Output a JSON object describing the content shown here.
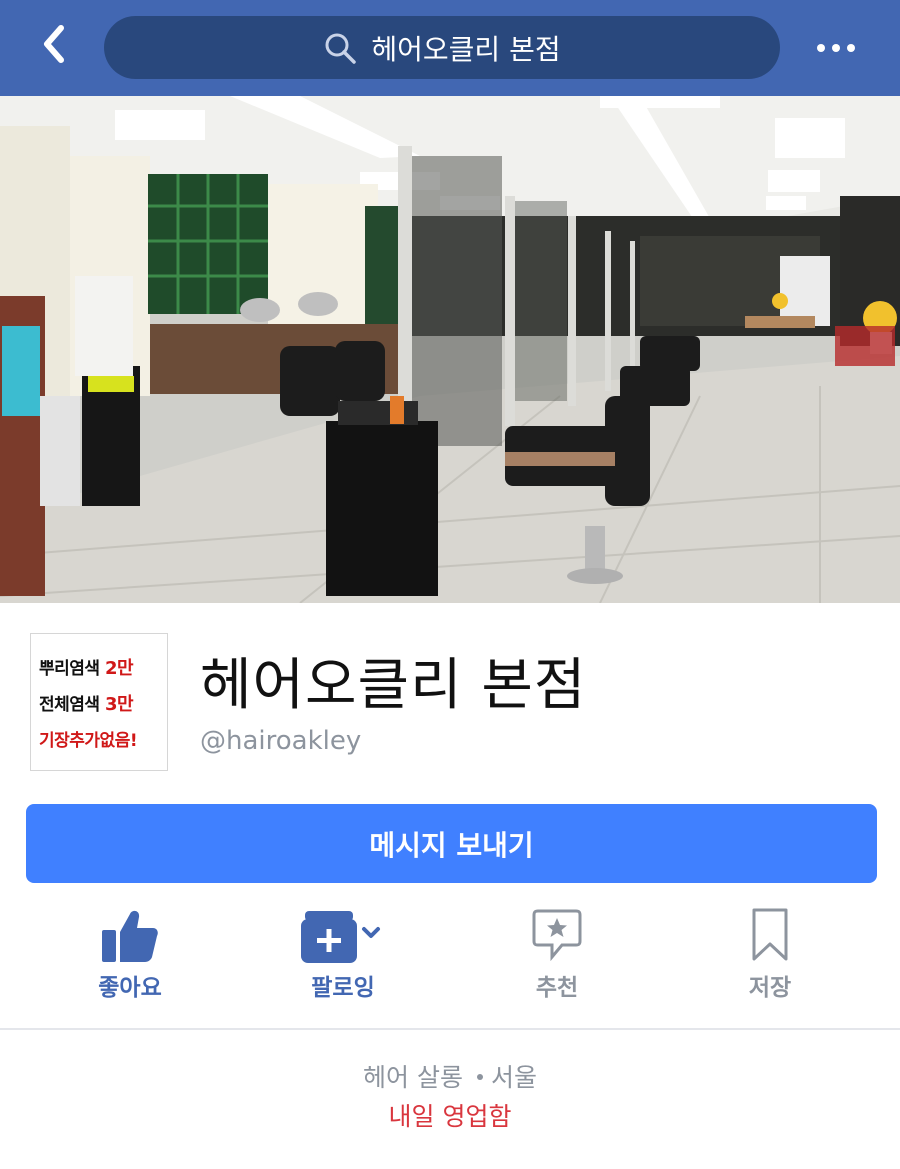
{
  "header": {
    "search_text": "헤어오클리 본점",
    "back_icon": "back-chevron-icon",
    "more_icon": "more-dots-icon",
    "bar_color": "#4267b2"
  },
  "cover": {
    "icon": "salon-interior-photo"
  },
  "profile": {
    "avatar_lines": [
      {
        "text": "뿌리염색",
        "num": "2만"
      },
      {
        "text": "전체염색",
        "num": "3만"
      },
      {
        "text": "기장추가없음!",
        "num": ""
      }
    ],
    "name": "헤어오클리 본점",
    "username": "@hairoakley"
  },
  "message_button": {
    "label": "메시지 보내기",
    "color": "#4080ff"
  },
  "actions": [
    {
      "label": "좋아요",
      "icon": "thumbs-up-icon",
      "color": "#4267b2"
    },
    {
      "label": "팔로잉",
      "icon": "following-icon",
      "color": "#4267b2"
    },
    {
      "label": "추천",
      "icon": "recommend-icon",
      "color": "#8d949e"
    },
    {
      "label": "저장",
      "icon": "bookmark-icon",
      "color": "#8d949e"
    }
  ],
  "info": {
    "category": "헤어 살롱",
    "location": "서울",
    "hours_status": "내일 영업함",
    "hours_color": "#d9363e"
  }
}
